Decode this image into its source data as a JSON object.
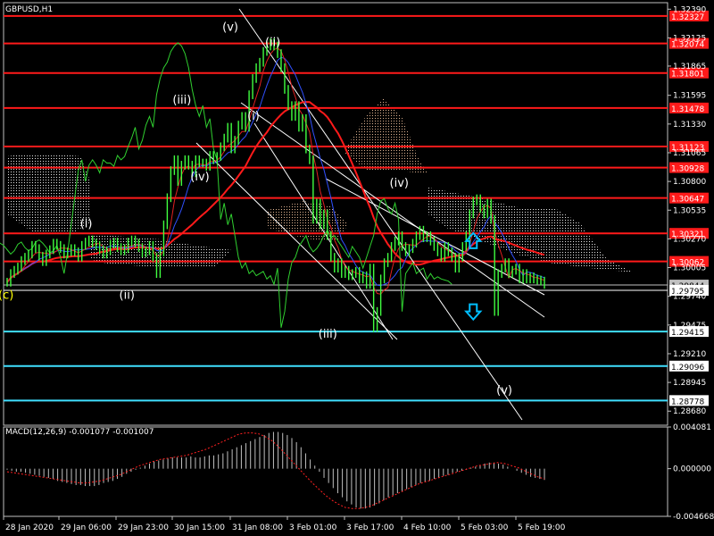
{
  "chart_data": [
    {
      "type": "line",
      "title": "GBPUSD,H1",
      "ylim": [
        1.2855,
        1.3245
      ],
      "y_ticks": [
        "1.32390",
        "1.32125",
        "1.31865",
        "1.31595",
        "1.31330",
        "1.31065",
        "1.30800",
        "1.30535",
        "1.30270",
        "1.30005",
        "1.29740",
        "1.29475",
        "1.29210",
        "1.28945",
        "1.28680"
      ],
      "x_ticks": [
        "28 Jan 2020",
        "29 Jan 06:00",
        "29 Jan 23:00",
        "30 Jan 15:00",
        "31 Jan 08:00",
        "3 Feb 01:00",
        "3 Feb 17:00",
        "4 Feb 10:00",
        "5 Feb 03:00",
        "5 Feb 19:00"
      ],
      "levels_red": [
        {
          "label": "1.32327",
          "value": 1.32327
        },
        {
          "label": "1.32074",
          "value": 1.32074
        },
        {
          "label": "1.31801",
          "value": 1.31801
        },
        {
          "label": "1.31478",
          "value": 1.31478
        },
        {
          "label": "1.31123",
          "value": 1.31123
        },
        {
          "label": "1.30928",
          "value": 1.30928
        },
        {
          "label": "1.30647",
          "value": 1.30647
        },
        {
          "label": "1.30321",
          "value": 1.30321
        },
        {
          "label": "1.30062",
          "value": 1.30062
        }
      ],
      "levels_cyan": [
        {
          "label": "1.29415",
          "value": 1.29415
        },
        {
          "label": "1.29096",
          "value": 1.29096
        },
        {
          "label": "1.28778",
          "value": 1.28778
        }
      ],
      "price_labels": [
        {
          "label": "1.29844",
          "value": 1.29844,
          "color": "#c0c0c0"
        },
        {
          "label": "1.29795",
          "value": 1.29795,
          "color": "#ffffff"
        }
      ],
      "price": {
        "x": [
          0,
          1,
          2,
          3,
          4,
          5,
          6,
          7,
          8,
          9,
          10,
          11,
          12,
          13,
          14,
          15,
          16,
          17,
          18,
          19,
          20,
          21,
          22,
          23,
          24,
          25,
          26,
          27,
          28,
          29,
          30,
          31,
          32,
          33,
          34,
          35,
          36,
          37,
          38,
          39,
          40,
          41,
          42,
          43,
          44,
          45,
          46,
          47,
          48,
          49,
          50,
          51,
          52,
          53,
          54,
          55,
          56,
          57,
          58,
          59,
          60,
          61,
          62,
          63,
          64,
          65,
          66,
          67,
          68,
          69,
          70,
          71,
          72,
          73,
          74,
          75,
          76,
          77,
          78,
          79,
          80,
          81,
          82,
          83,
          84,
          85,
          86,
          87,
          88,
          89,
          90,
          91,
          92,
          93,
          94,
          95,
          96,
          97,
          98,
          99,
          100,
          101,
          102,
          103,
          104,
          105,
          106,
          107,
          108,
          109,
          110,
          111,
          112,
          113,
          114,
          115,
          116,
          117,
          118,
          119,
          120,
          121,
          122,
          123,
          124,
          125,
          126,
          127,
          128,
          129,
          130,
          131,
          132,
          133,
          134,
          135,
          136,
          137,
          138,
          139,
          140,
          141,
          142,
          143,
          144,
          145,
          146,
          147,
          148,
          149,
          150,
          151
        ],
        "y": [
          1.2987,
          1.2995,
          1.2998,
          1.3001,
          1.3007,
          1.301,
          1.3013,
          1.3021,
          1.3018,
          1.3011,
          1.3006,
          1.3013,
          1.3017,
          1.3023,
          1.3021,
          1.3018,
          1.3013,
          1.3015,
          1.3018,
          1.3015,
          1.301,
          1.3021,
          1.3024,
          1.3026,
          1.3023,
          1.3021,
          1.3017,
          1.3013,
          1.3016,
          1.3022,
          1.3024,
          1.3019,
          1.3016,
          1.3018,
          1.3024,
          1.3026,
          1.3023,
          1.3019,
          1.3014,
          1.3016,
          1.3021,
          1.301,
          1.2995,
          1.3015,
          1.304,
          1.3065,
          1.309,
          1.31,
          1.308,
          1.3095,
          1.31,
          1.3095,
          1.3088,
          1.31,
          1.3097,
          1.3097,
          1.3094,
          1.3104,
          1.31,
          1.3103,
          1.3112,
          1.312,
          1.313,
          1.311,
          1.3118,
          1.3132,
          1.314,
          1.313,
          1.316,
          1.3175,
          1.3185,
          1.319,
          1.32,
          1.3205,
          1.3208,
          1.3205,
          1.3198,
          1.3185,
          1.3165,
          1.315,
          1.314,
          1.315,
          1.313,
          1.3138,
          1.311,
          1.31,
          1.3045,
          1.306,
          1.304,
          1.305,
          1.303,
          1.301,
          1.3,
          1.3005,
          1.2995,
          1.2998,
          1.2993,
          1.2995,
          1.2997,
          1.299,
          1.2993,
          1.2985,
          1.3,
          1.2945,
          1.296,
          1.299,
          1.3005,
          1.301,
          1.302,
          1.3025,
          1.303,
          1.302,
          1.3015,
          1.3018,
          1.3023,
          1.303,
          1.3035,
          1.3028,
          1.303,
          1.3025,
          1.302,
          1.3015,
          1.301,
          1.302,
          1.3015,
          1.301,
          1.3,
          1.301,
          1.302,
          1.303,
          1.305,
          1.3062,
          1.3064,
          1.3055,
          1.305,
          1.306,
          1.3045,
          1.296,
          1.2995,
          1.3,
          1.3005,
          1.2995,
          1.2998,
          1.3,
          1.299,
          1.2995,
          1.299,
          1.2992,
          1.299,
          1.2989,
          1.2988,
          1.2985
        ]
      },
      "wave_labels": [
        {
          "text": "(c)",
          "value": 1.29715,
          "bar": 0,
          "color": "#ffff00"
        },
        {
          "text": "(i)",
          "value": 1.30375,
          "bar": 23,
          "color": "#ffffff"
        },
        {
          "text": "(ii)",
          "value": 1.29715,
          "bar": 34,
          "color": "#ffffff"
        },
        {
          "text": "(iii)",
          "value": 1.3152,
          "bar": 49,
          "color": "#ffffff"
        },
        {
          "text": "(iv)",
          "value": 1.3081,
          "bar": 54,
          "color": "#ffffff"
        },
        {
          "text": "(v)",
          "value": 1.3219,
          "bar": 63,
          "color": "#ffffff"
        },
        {
          "text": "(ii)",
          "value": 1.3205,
          "bar": 75,
          "color": "#ffffff"
        },
        {
          "text": "(i)",
          "value": 1.3137,
          "bar": 70,
          "color": "#ffffff"
        },
        {
          "text": "(iii)",
          "value": 1.2936,
          "bar": 90,
          "color": "#ffffff"
        },
        {
          "text": "(iv)",
          "value": 1.3075,
          "bar": 110,
          "color": "#ffffff"
        },
        {
          "text": "(v)",
          "value": 1.2884,
          "bar": 140,
          "color": "#ffffff"
        }
      ],
      "arrows": [
        {
          "direction": "up",
          "value": 1.3025,
          "bar": 131,
          "color": "#00bfff"
        },
        {
          "direction": "down",
          "value": 1.296,
          "bar": 131,
          "color": "#00bfff"
        }
      ]
    },
    {
      "type": "bar",
      "title": "MACD(12,26,9) -0.001077 -0.001007",
      "ylim": [
        -0.004668,
        0.004081
      ],
      "y_ticks": [
        "0.004081",
        "0.000000",
        "-0.004668"
      ],
      "values": [
        -0.0001,
        -0.0002,
        -0.0003,
        -0.0003,
        -0.0004,
        -0.0005,
        -0.0006,
        -0.0007,
        -0.0008,
        -0.0009,
        -0.001,
        -0.0012,
        -0.0013,
        -0.0014,
        -0.0015,
        -0.0016,
        -0.0016,
        -0.0017,
        -0.0017,
        -0.0017,
        -0.0016,
        -0.0014,
        -0.0013,
        -0.0012,
        -0.001,
        -0.0008,
        -0.0005,
        -0.0003,
        -0.0001,
        0.0001,
        0.0003,
        0.0005,
        0.0007,
        0.0008,
        0.0009,
        0.001,
        0.0011,
        0.0011,
        0.0011,
        0.0011,
        0.0012,
        0.0011,
        0.0011,
        0.0012,
        0.0013,
        0.0013,
        0.0014,
        0.0015,
        0.0017,
        0.0019,
        0.0021,
        0.0023,
        0.0025,
        0.0027,
        0.0029,
        0.0031,
        0.0033,
        0.0035,
        0.0036,
        0.0036,
        0.0035,
        0.0033,
        0.003,
        0.0026,
        0.0021,
        0.0015,
        0.0009,
        0.0003,
        -0.0003,
        -0.0009,
        -0.0014,
        -0.0019,
        -0.0024,
        -0.0028,
        -0.0032,
        -0.0035,
        -0.0038,
        -0.0039,
        -0.0039,
        -0.0038,
        -0.0036,
        -0.0034,
        -0.0031,
        -0.0028,
        -0.0026,
        -0.0024,
        -0.0022,
        -0.002,
        -0.0018,
        -0.0016,
        -0.0014,
        -0.0013,
        -0.0012,
        -0.001,
        -0.0009,
        -0.0007,
        -0.0006,
        -0.0004,
        -0.0003,
        -0.0002,
        -0.0001,
        0.0001,
        0.0002,
        0.0003,
        0.0005,
        0.0006,
        0.0006,
        0.0005,
        0.0004,
        0.0002,
        0.0,
        -0.0002,
        -0.0004,
        -0.0006,
        -0.0008,
        -0.0009,
        -0.001,
        -0.0011
      ],
      "signal": [
        -0.0003,
        -0.0004,
        -0.0005,
        -0.0006,
        -0.0007,
        -0.0008,
        -0.0009,
        -0.001,
        -0.0011,
        -0.0012,
        -0.0013,
        -0.0014,
        -0.0014,
        -0.0013,
        -0.0012,
        -0.001,
        -0.0008,
        -0.0006,
        -0.0003,
        0.0,
        0.0003,
        0.0005,
        0.0007,
        0.0009,
        0.001,
        0.0011,
        0.0012,
        0.0013,
        0.0015,
        0.0017,
        0.0019,
        0.0022,
        0.0025,
        0.0028,
        0.0031,
        0.0034,
        0.0035,
        0.0035,
        0.0034,
        0.0031,
        0.0027,
        0.0021,
        0.0014,
        0.0007,
        0.0,
        -0.0007,
        -0.0014,
        -0.002,
        -0.0026,
        -0.0031,
        -0.0035,
        -0.0038,
        -0.0039,
        -0.0039,
        -0.0038,
        -0.0036,
        -0.0033,
        -0.003,
        -0.0027,
        -0.0024,
        -0.0021,
        -0.0018,
        -0.0015,
        -0.0013,
        -0.0011,
        -0.0009,
        -0.0007,
        -0.0005,
        -0.0003,
        -0.0001,
        0.0001,
        0.0003,
        0.0004,
        0.0005,
        0.0006,
        0.0005,
        0.0003,
        0.0001,
        -0.0002,
        -0.0005,
        -0.0008,
        -0.001
      ]
    }
  ]
}
